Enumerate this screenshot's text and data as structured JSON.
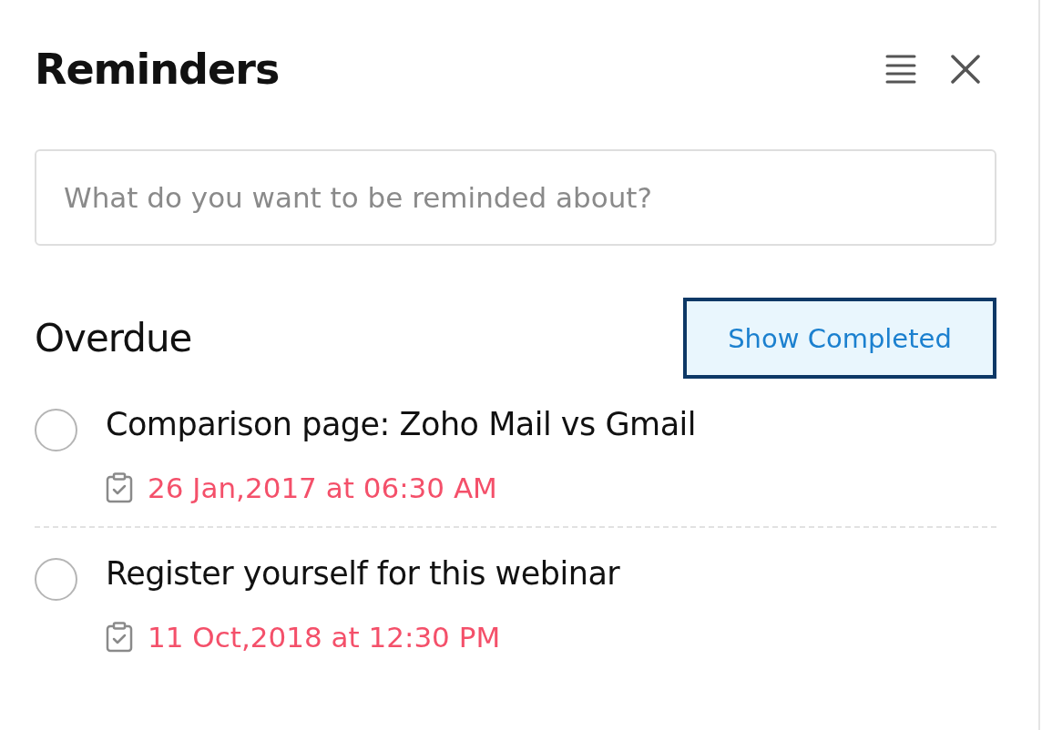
{
  "title": "Reminders",
  "search": {
    "placeholder": "What do you want to be reminded about?"
  },
  "section": {
    "title": "Overdue",
    "toggle_button": "Show Completed"
  },
  "reminders": [
    {
      "text": "Comparison page: Zoho Mail vs Gmail",
      "due": "26 Jan,2017 at 06:30 AM",
      "checked": false
    },
    {
      "text": "Register yourself for this webinar",
      "due": "11 Oct,2018 at 12:30 PM",
      "checked": false
    }
  ]
}
